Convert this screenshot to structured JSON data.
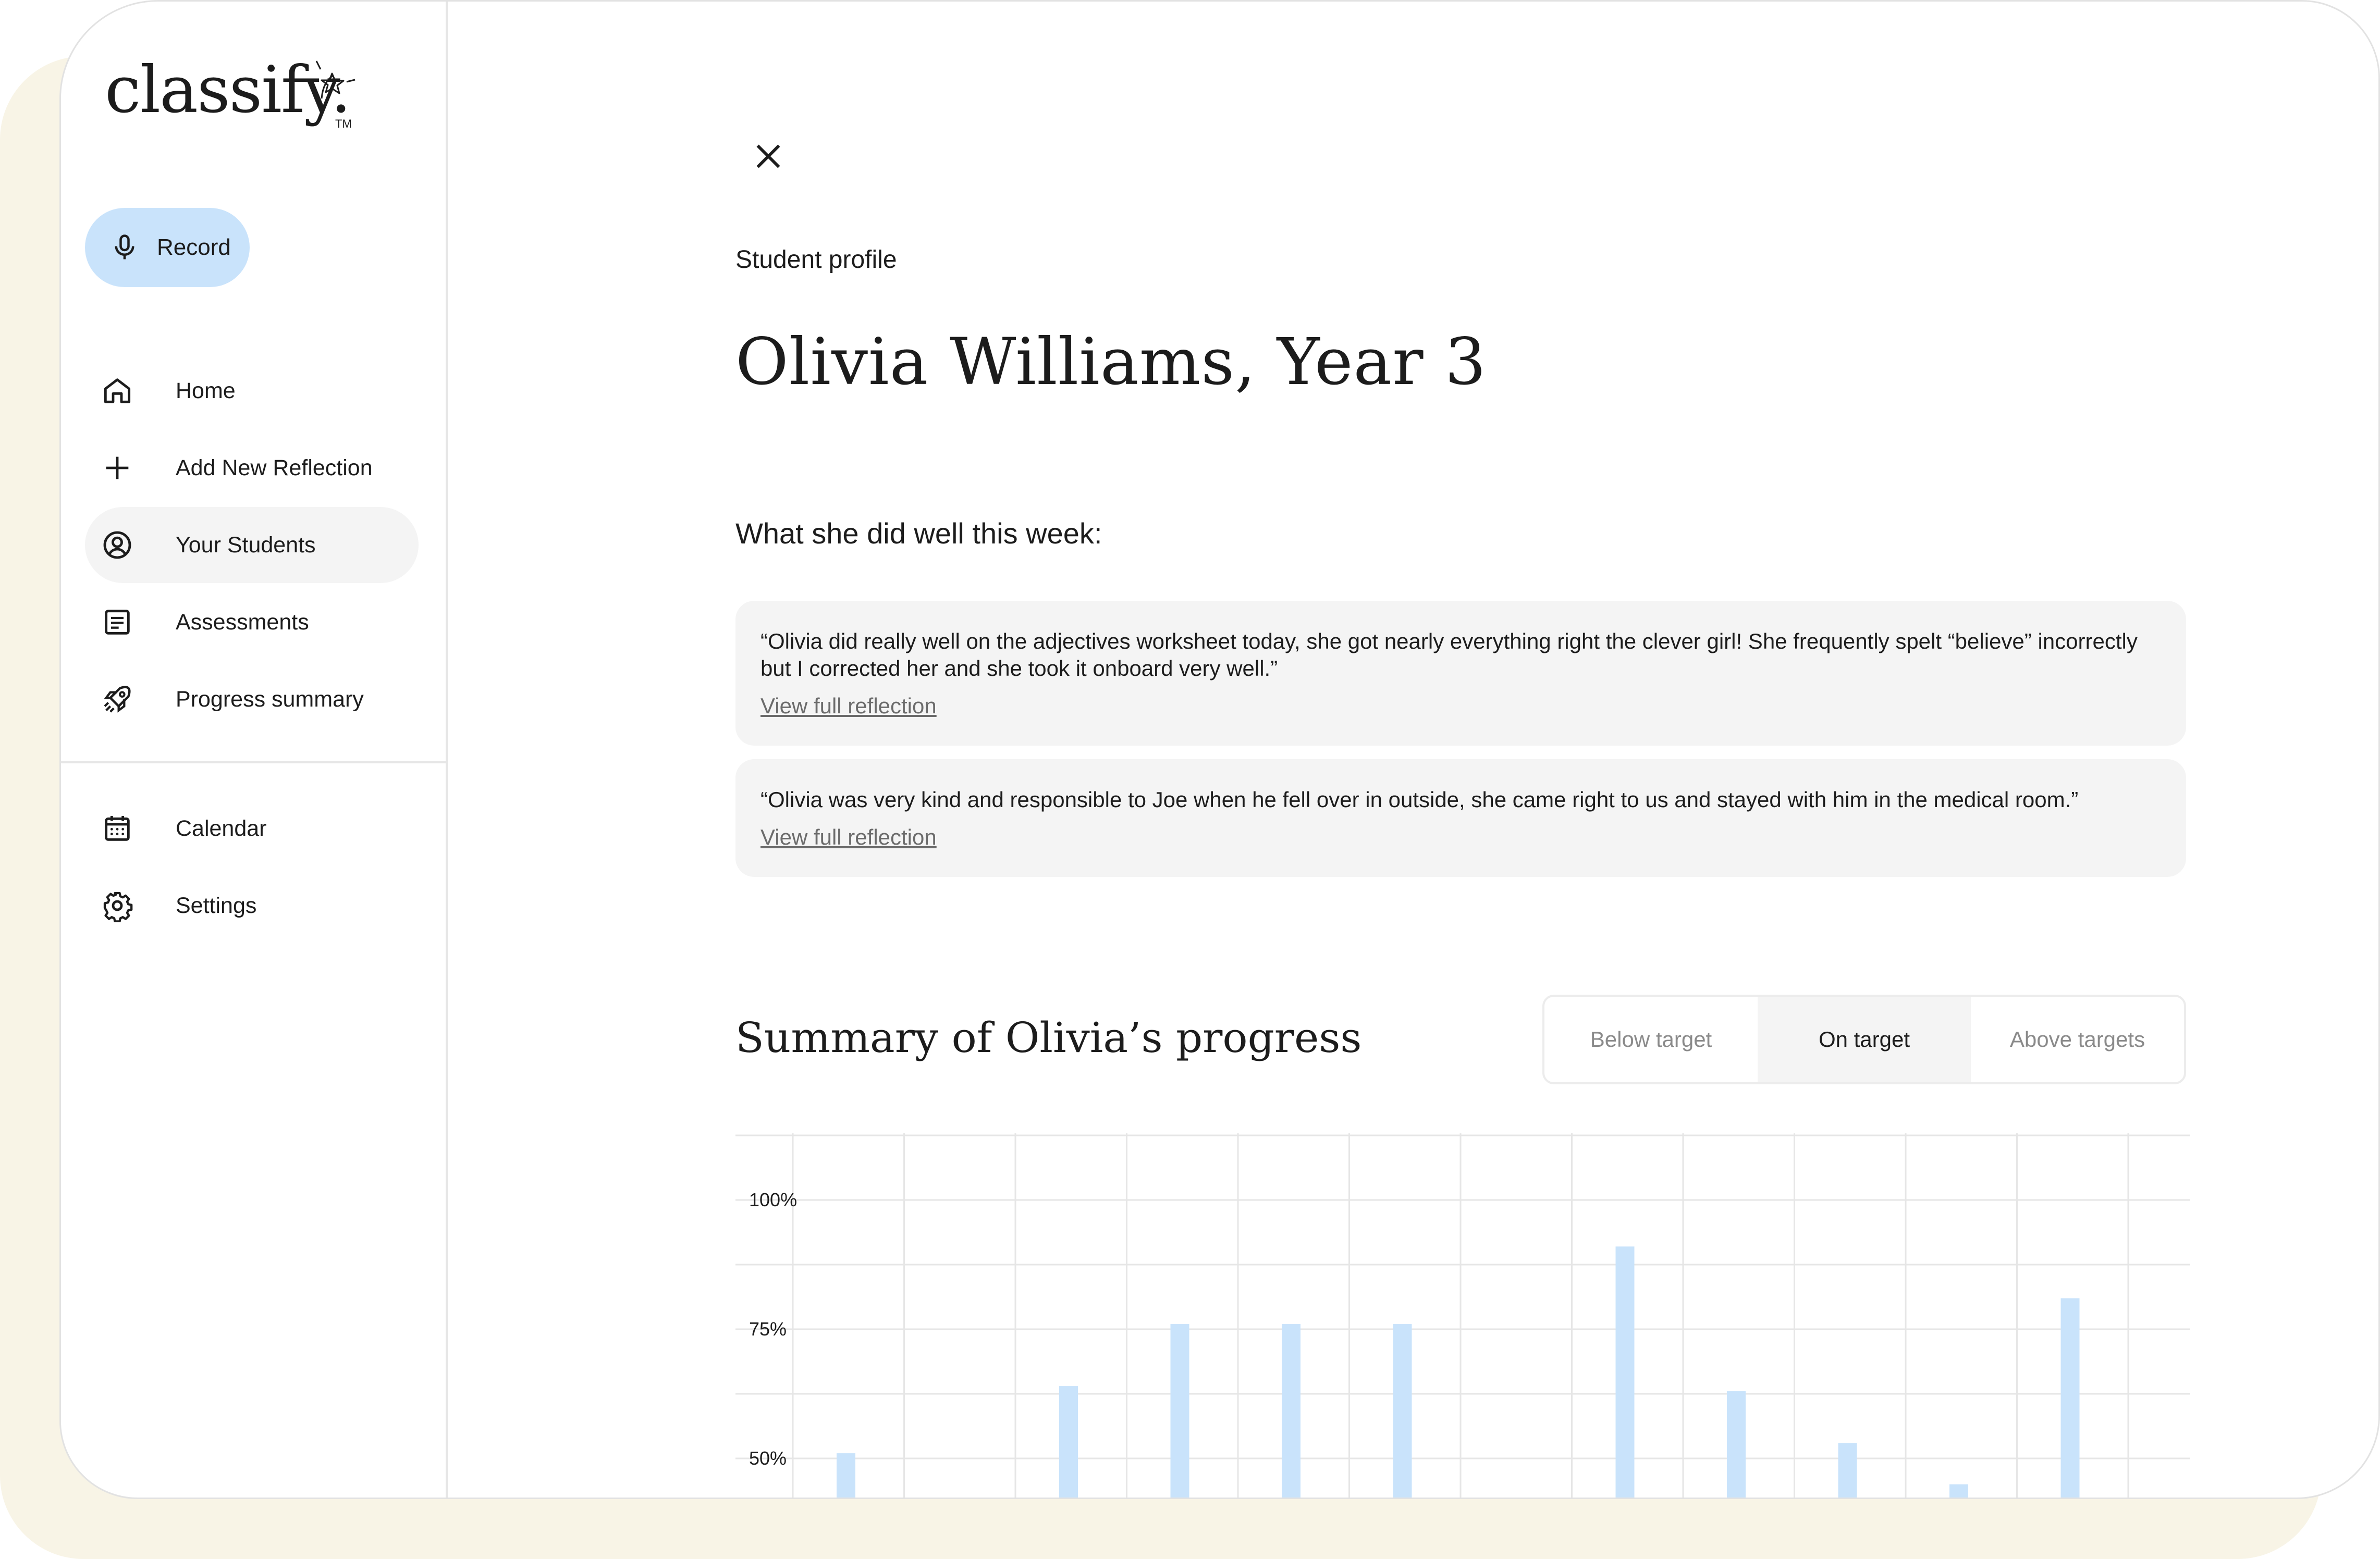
{
  "brand": {
    "name": "classify.",
    "tm": "TM"
  },
  "record": {
    "label": "Record"
  },
  "nav": {
    "items": [
      {
        "label": "Home",
        "icon": "home-icon"
      },
      {
        "label": "Add New Reflection",
        "icon": "plus-icon"
      },
      {
        "label": "Your Students",
        "icon": "user-circle-icon",
        "active": true
      },
      {
        "label": "Assessments",
        "icon": "document-icon"
      },
      {
        "label": "Progress summary",
        "icon": "rocket-icon"
      }
    ],
    "secondary": [
      {
        "label": "Calendar",
        "icon": "calendar-icon"
      },
      {
        "label": "Settings",
        "icon": "gear-icon"
      }
    ]
  },
  "main": {
    "breadcrumb": "Student profile",
    "title": "Olivia Williams, Year 3",
    "subtitle": "What she did well this week:",
    "reflections": [
      {
        "quote": "“Olivia did really well on the adjectives worksheet today, she got nearly everything right the clever girl! She frequently spelt “believe” incorrectly but I corrected her and she took it onboard very well.”",
        "link": "View full reflection"
      },
      {
        "quote": "“Olivia was very kind and responsible to Joe when he fell over in outside, she came right to us and stayed with him in the medical room.”",
        "link": "View full reflection"
      }
    ],
    "summary_title": "Summary of Olivia’s progress",
    "filter": {
      "options": [
        "Below target",
        "On target",
        "Above targets"
      ],
      "selected": "On target"
    }
  },
  "colors": {
    "accent": "#c9e3fb",
    "backdrop": "#f8f4e6",
    "card": "#f4f4f4"
  },
  "chart_data": {
    "type": "bar",
    "y_ticks": [
      "100%",
      "75%",
      "50%"
    ],
    "values": [
      51,
      null,
      64,
      76,
      76,
      76,
      null,
      91,
      63,
      53,
      45,
      81,
      null
    ],
    "ylim": [
      45,
      100
    ],
    "grid": true
  }
}
